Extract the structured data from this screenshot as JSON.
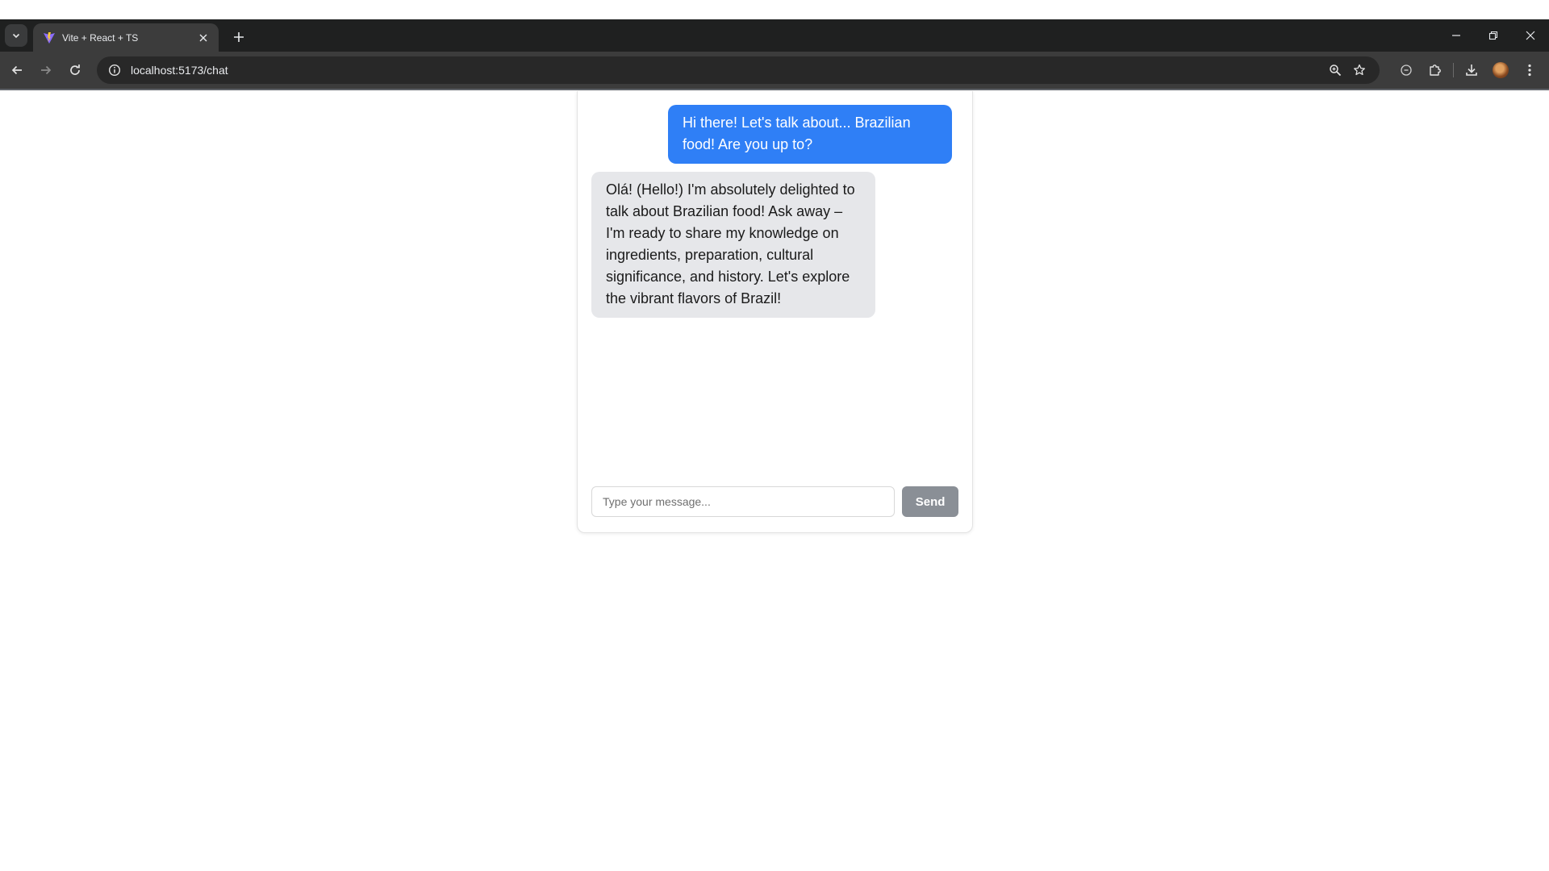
{
  "browser": {
    "tab": {
      "title": "Vite + React + TS"
    },
    "new_tab_label": "+",
    "url": "localhost:5173/chat"
  },
  "chat": {
    "messages": [
      {
        "role": "user",
        "text": "Hi there! Let's talk about... Brazilian food! Are you up to?"
      },
      {
        "role": "assistant",
        "text": "Olá! (Hello!) I'm absolutely delighted to talk about Brazilian food! Ask away – I'm ready to share my knowledge on ingredients, preparation, cultural significance, and history. Let's explore the vibrant flavors of Brazil!"
      }
    ],
    "input": {
      "placeholder": "Type your message...",
      "value": ""
    },
    "send_label": "Send"
  },
  "colors": {
    "user_bubble": "#2f7ff6",
    "assistant_bubble": "#e6e7ea",
    "send_button": "#8a8f96"
  }
}
